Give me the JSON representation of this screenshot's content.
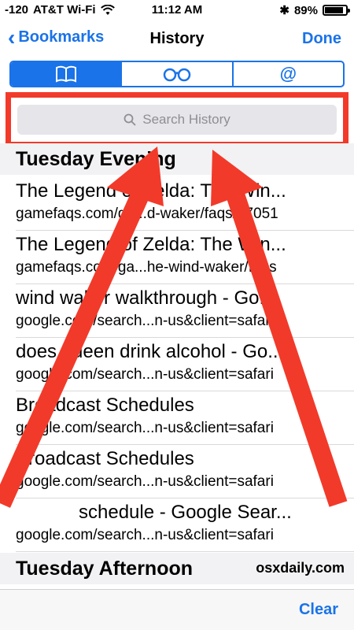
{
  "status_bar": {
    "signal": "-120",
    "carrier": "AT&T Wi-Fi",
    "time": "11:12 AM",
    "battery": "89%",
    "battery_level": 0.89
  },
  "nav": {
    "back_label": "Bookmarks",
    "title": "History",
    "done_label": "Done"
  },
  "segments": [
    {
      "icon": "book-icon",
      "active": true
    },
    {
      "icon": "reading-list-glasses-icon",
      "active": false
    },
    {
      "icon": "shared-links-at-icon",
      "active": false
    }
  ],
  "search": {
    "placeholder": "Search History"
  },
  "sections": [
    {
      "title": "Tuesday Evening",
      "items": [
        {
          "title": "The Legend of Zelda: The Win...",
          "url": "gamefaqs.com/ga...d-waker/faqs/57051"
        },
        {
          "title": "The Legend of Zelda: The Win...",
          "url": "gamefaqs.com/ga...he-wind-waker/faqs"
        },
        {
          "title": "wind waker walkthrough - Go...",
          "url": "google.com/search...n-us&client=safari"
        },
        {
          "title": "does queen drink alcohol - Go...",
          "url": "google.com/search...n-us&client=safari"
        },
        {
          "title": "Broadcast Schedules",
          "url": "google.com/search...n-us&client=safari"
        },
        {
          "title": "Broadcast Schedules",
          "url": "google.com/search...n-us&client=safari"
        },
        {
          "title": "schedule - Google Sear...",
          "url": "google.com/search...n-us&client=safari"
        }
      ]
    },
    {
      "title": "Tuesday Afternoon",
      "items": []
    }
  ],
  "watermark": "osxdaily.com",
  "toolbar": {
    "clear_label": "Clear"
  },
  "colors": {
    "accent": "#1a73e8",
    "annotation_red": "#f23a2a"
  }
}
